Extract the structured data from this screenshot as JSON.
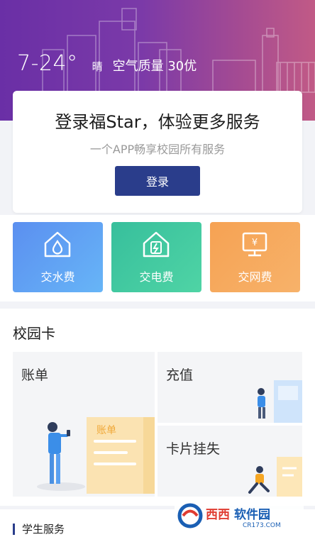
{
  "weather": {
    "temperature": "7-24°",
    "condition": "晴",
    "air_quality": "空气质量 30优"
  },
  "login": {
    "title": "登录福Star，体验更多服务",
    "subtitle": "一个APP畅享校园所有服务",
    "button_label": "登录"
  },
  "quick_actions": [
    {
      "label": "交水费",
      "icon": "water-house-icon",
      "color": "#5b8ff0"
    },
    {
      "label": "交电费",
      "icon": "electricity-house-icon",
      "color": "#37bf9c"
    },
    {
      "label": "交网费",
      "icon": "network-monitor-icon",
      "color": "#f6a253"
    }
  ],
  "campus_card": {
    "title": "校园卡",
    "features": [
      {
        "label": "账单",
        "illustration_text": "账单"
      },
      {
        "label": "充值"
      },
      {
        "label": "卡片挂失"
      }
    ]
  },
  "student_services": {
    "title": "学生服务"
  },
  "watermark": {
    "brand": "西西软件园",
    "domain": "CR173.COM"
  }
}
